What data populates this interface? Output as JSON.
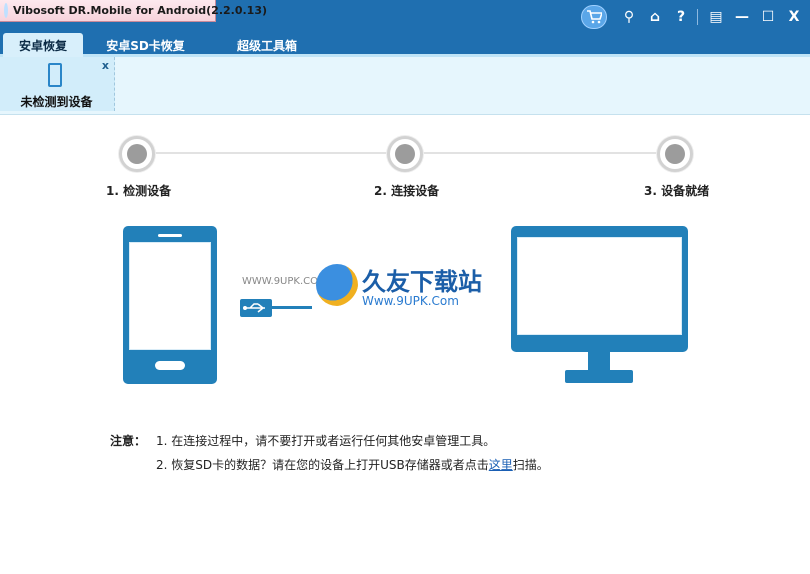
{
  "window": {
    "title": "Vibosoft DR.Mobile for Android(2.2.0.13)",
    "icons": [
      "cart-icon",
      "search-icon",
      "home-icon",
      "help-icon",
      "feedback-icon",
      "minimize-icon",
      "maximize-icon",
      "close-icon"
    ],
    "glyphs": {
      "search": "⚲",
      "home": "⌂",
      "help": "?",
      "feedback": "▤",
      "minimize": "—",
      "maximize": "☐",
      "close": "X"
    }
  },
  "tabs": [
    {
      "label": "安卓恢复",
      "active": true
    },
    {
      "label": "安卓SD卡恢复",
      "active": false
    },
    {
      "label": "超级工具箱",
      "active": false
    }
  ],
  "device": {
    "label": "未检测到设备",
    "close": "x"
  },
  "steps": [
    {
      "label": "1. 检测设备"
    },
    {
      "label": "2. 连接设备"
    },
    {
      "label": "3. 设备就绪"
    }
  ],
  "watermark": {
    "name": "久友下载站",
    "url": "Www.9UPK.Com",
    "left": "WWW.9UPK.COM"
  },
  "notes": {
    "title": "注意：",
    "line1": "1. 在连接过程中，请不要打开或者运行任何其他安卓管理工具。",
    "line2_prefix": "2. 恢复SD卡的数据？请在您的设备上打开USB存储器或者点击",
    "line2_link": "这里",
    "line2_suffix": "扫描。"
  },
  "colors": {
    "titlebar": "#1f6fb0",
    "accent": "#2280b9",
    "link": "#1a5fb4"
  }
}
